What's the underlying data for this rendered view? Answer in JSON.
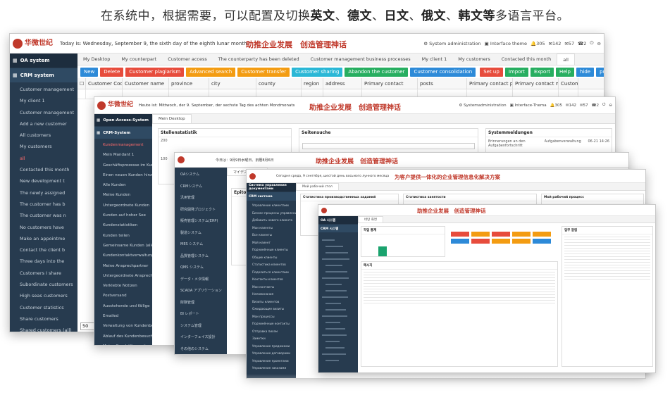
{
  "caption": {
    "prefix": "在系统中，根据需要，可以配置及切换",
    "en": "英文",
    "sep1": "、",
    "de": "德文",
    "sep2": "、",
    "ja": "日文",
    "sep3": "、",
    "ru": "俄文",
    "sep4": "、",
    "ko": "韩文",
    "suffix_bold": "等",
    "suffix": "多语言平台。"
  },
  "w1": {
    "logo": "华微世纪",
    "date": "Today is: Wednesday, September 9, the sixth day of the eighth lunar month",
    "slogan": "助推企业发展　创造管理神话",
    "tools": {
      "admin": "System administration",
      "theme": "Interface theme",
      "bell": "305",
      "msg": "142",
      "mail": "57",
      "chat": "2"
    },
    "side_head1": "OA system",
    "side_head2": "CRM system",
    "side": [
      "Customer management",
      "My client 1",
      "Customer management",
      "Add a new customer",
      "All customers",
      "My customers",
      "all",
      "Contacted this month",
      "New development t",
      "The newly assigned",
      "The customer has b",
      "The customer was n",
      "No customers have",
      "Make an appointme",
      "Contact the client b",
      "Three days into the",
      "Customers I share",
      "Subordinate customers",
      "High seas customers",
      "Customer statistics",
      "Share customers",
      "Shared customers (all)"
    ],
    "tabs": [
      "My Desktop",
      "My counterpart",
      "Customer access",
      "The counterparty has been deleted",
      "Customer management business processes",
      "My client 1",
      "My customers",
      "Contacted this month",
      "all"
    ],
    "buttons": [
      {
        "t": "New",
        "c": "#2d8ad8"
      },
      {
        "t": "Delete",
        "c": "#e74c3c"
      },
      {
        "t": "Customer plagiarism",
        "c": "#e74c3c"
      },
      {
        "t": "Advanced search",
        "c": "#f39c12"
      },
      {
        "t": "Customer transfer",
        "c": "#f39c12"
      },
      {
        "t": "Customer sharing",
        "c": "#2ab7d6"
      },
      {
        "t": "Abandon the customer",
        "c": "#27ae60"
      },
      {
        "t": "Customer consolidation",
        "c": "#2d8ad8"
      }
    ],
    "rbuttons": [
      {
        "t": "Set up",
        "c": "#e74c3c"
      },
      {
        "t": "Import",
        "c": "#27ae60"
      },
      {
        "t": "Export",
        "c": "#27ae60"
      },
      {
        "t": "Help",
        "c": "#27ae60"
      },
      {
        "t": "hide",
        "c": "#2d8ad8"
      },
      {
        "t": "purge",
        "c": "#2d8ad8"
      }
    ],
    "cols": [
      "Customer Code",
      "Customer name",
      "province",
      "city",
      "county",
      "region",
      "address",
      "Primary contact",
      "posts",
      "Primary contact phone",
      "Primary contact mailbox",
      "Custom"
    ],
    "pagesize": "50"
  },
  "w2": {
    "logo": "华微世纪",
    "date": "Heute ist: Mittwoch, der 9. September, der sechste Tag des achten Mondmonats",
    "slogan": "助推企业发展　创造管理神话",
    "tools": {
      "admin": "Systemadministration",
      "theme": "Interface-Thema",
      "bell": "305",
      "msg": "142",
      "mail": "57",
      "chat": "2"
    },
    "side_head1": "Open-Access-System",
    "side_head2": "CRM-System",
    "side": [
      "Kundenmanagement",
      "Mein Mandant 1",
      "Geschäftsprozesse im Kunde",
      "Einen neuen Kunden hinzu",
      "Alle Kunden",
      "Meine Kunden",
      "Untergeordnete Kunden",
      "Kunden auf hoher See",
      "Kundenstatistiken",
      "Kunden teilen",
      "Gemeinsame Kunden (alle)",
      "Kundenkontaktverwaltung",
      "Meine Ansprechpartner",
      "Untergeordnete Ansprechpartner",
      "Verklebte Notizen",
      "Postversand",
      "Ausstehende und fällige",
      "Emailed",
      "Verwaltung von Kundenbe",
      "Ablauf des Kundenbesuchs",
      "Meine Geschäftsvorgänge"
    ],
    "tab": "Mein Desktop",
    "box1": "Stellenstatistik",
    "box2": "Seitensuche",
    "box3": "Systemmeldungen",
    "b3row": "Erinnerungen an den Aufgabenfortschritt",
    "b3right": "Aufgabenverwaltung",
    "b3date": "06-21 14:26",
    "y200": "200",
    "y100": "100"
  },
  "w3": {
    "date": "今日は：9月9日水曜日、旧暦8月6日",
    "slogan": "助推企业发展　创造管理神话",
    "side": [
      "OAシステム",
      "CRMシステム",
      "汎用管理",
      "研究開発プロジェクト",
      "販売管理システム(ERP)",
      "製造システム",
      "MES システム",
      "品質管理システム",
      "QMS システム",
      "データ・メタ情報",
      "SCADA アプリケーション",
      "財務管理",
      "BI レポート",
      "システム管理",
      "インターフェイス設計",
      "その他のシステム"
    ],
    "tab": "マイデスクトップ",
    "box1": "Epito"
  },
  "w4": {
    "date": "Сегодня среда, 9 сентября, шестой день восьмого лунного месяца",
    "slogan": "为客户提供一体化的企业管理信息化解决方案",
    "side_head1": "Система управления документами",
    "side_head2": "CRM система",
    "side": [
      "Управление клиентами",
      "Бизнес-процессы управления",
      "Добавить нового клиента",
      "Мои клиенты",
      "Все клиенты",
      "Мой клиент",
      "Подчинённые клиенты",
      "Общие клиенты",
      "Статистика клиентов",
      "Поделиться клиентами",
      "Контакты клиентов",
      "Мои контакты",
      "Напоминания",
      "Визиты клиентов",
      "Ожидающие визиты",
      "Мои процессы",
      "Подчинённые контакты",
      "Отправка писем",
      "Заметки",
      "Управление продажами",
      "Управление договорами",
      "Управление проектами",
      "Управление заказами"
    ],
    "tab": "Мой рабочий стол",
    "box1": "Статистика производственных заданий",
    "box2": "Статистика занятости",
    "box3": "Мой рабочий процесс"
  },
  "w5": {
    "slogan": "助推企业发展　创造管理神话",
    "side_head1": "OA 시스템",
    "side_head2": "CRM 시스템",
    "tab": "바탕 화면",
    "btncolors": [
      "#e74c3c",
      "#f39c12",
      "#e74c3c",
      "#f39c12",
      "#f39c12",
      "#2d8ad8",
      "#e74c3c",
      "#f39c12",
      "#f39c12",
      "#2d8ad8"
    ],
    "box1": "작업 통계",
    "box2": "메시지",
    "box3": "업무 알림",
    "bar_value": 0.7
  },
  "colors": {
    "sidebar": "#273b4f",
    "sidebar_head": "#1d2d3e",
    "brand_red": "#c0392b",
    "chart_green": "#1aa36e"
  }
}
